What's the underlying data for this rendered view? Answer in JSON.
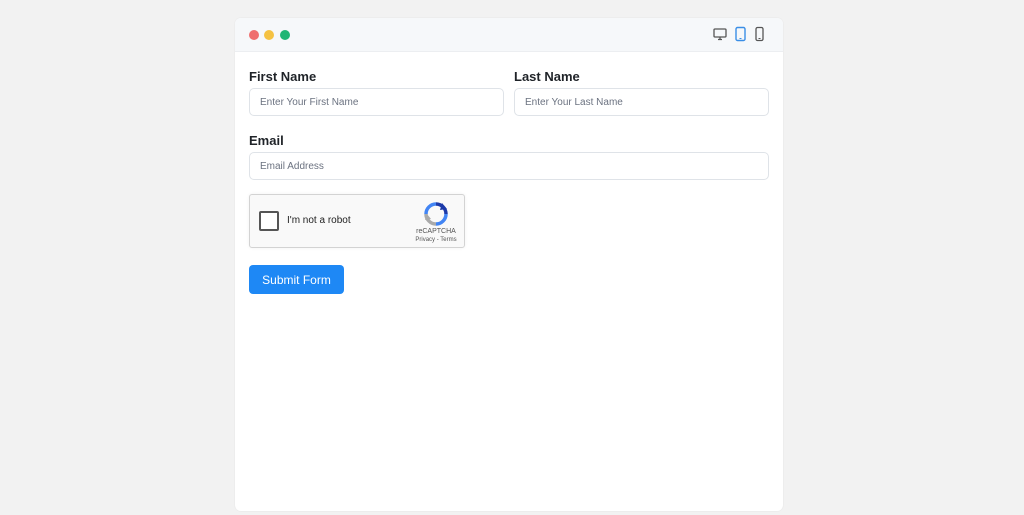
{
  "window": {
    "controls": [
      "close",
      "minimize",
      "maximize"
    ],
    "device_icons": [
      "desktop-icon",
      "tablet-icon",
      "phone-icon"
    ],
    "active_device": "tablet"
  },
  "form": {
    "first_name": {
      "label": "First Name",
      "placeholder": "Enter Your First Name",
      "value": ""
    },
    "last_name": {
      "label": "Last Name",
      "placeholder": "Enter Your Last Name",
      "value": ""
    },
    "email": {
      "label": "Email",
      "placeholder": "Email Address",
      "value": ""
    },
    "captcha": {
      "label": "I'm not a robot",
      "brand": "reCAPTCHA",
      "links": "Privacy - Terms",
      "checked": false
    },
    "submit_label": "Submit Form"
  },
  "colors": {
    "background": "#f2f2f2",
    "window": "#ffffff",
    "titlebar": "#f6f8fa",
    "close_dot": "#ef6e6e",
    "minimize_dot": "#f5c242",
    "maximize_dot": "#1fb574",
    "accent": "#1e88f5",
    "active_device": "#3a8ee6"
  }
}
